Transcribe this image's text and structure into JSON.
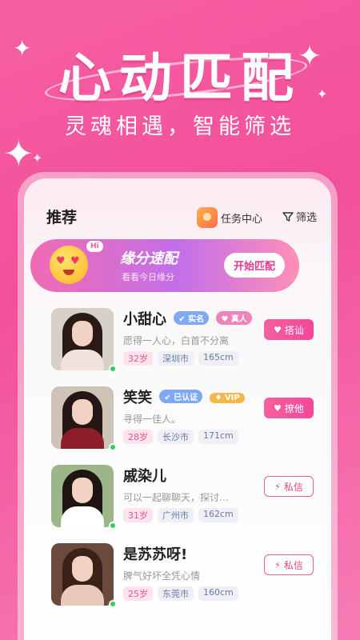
{
  "hero": {
    "title": "心动匹配",
    "subtitle": "灵魂相遇，智能筛选"
  },
  "header": {
    "title": "推荐",
    "task_center": "任务中心",
    "filter": "筛选"
  },
  "banner": {
    "bubble": "Hi",
    "title": "缘分速配",
    "subtitle": "看看今日缘分",
    "button": "开始匹配"
  },
  "users": [
    {
      "name": "小甜心",
      "badges": [
        "实名",
        "真人"
      ],
      "desc": "愿得一人心，白首不分离",
      "age": "32岁",
      "city": "深圳市",
      "height": "165cm",
      "action": "搭讪",
      "hair_color": "#2a1a17",
      "body_color": "#f2e2dc",
      "bg_color": "#d7d0c8"
    },
    {
      "name": "笑笑",
      "badges": [
        "已认证",
        "VIP"
      ],
      "desc": "寻得一佳人。",
      "age": "28岁",
      "city": "长沙市",
      "height": "171cm",
      "action": "撩他",
      "hair_color": "#241614",
      "body_color": "#8e1f2a",
      "bg_color": "#cfc2b6"
    },
    {
      "name": "戚染儿",
      "badges": [],
      "desc": "可以一起聊聊天，探讨...",
      "age": "31岁",
      "city": "广州市",
      "height": "162cm",
      "action": "私信",
      "hair_color": "#1f1412",
      "body_color": "#ffffff",
      "bg_color": "#9cb68a"
    },
    {
      "name": "是苏苏呀!",
      "badges": [],
      "desc": "脾气好坏全凭心情",
      "age": "25岁",
      "city": "东莞市",
      "height": "160cm",
      "action": "私信",
      "hair_color": "#3a2219",
      "body_color": "#e9c9bc",
      "bg_color": "#6b4a3e"
    }
  ]
}
